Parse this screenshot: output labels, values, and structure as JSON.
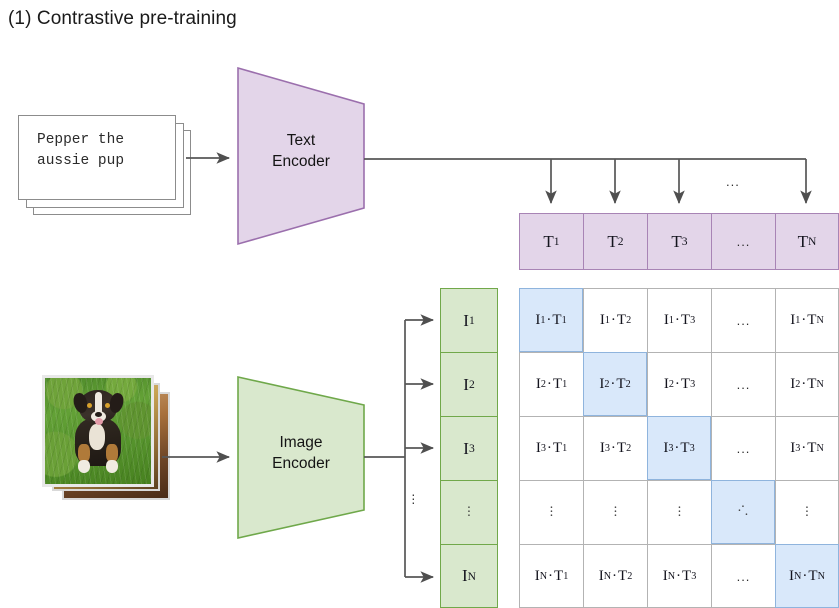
{
  "title": "(1) Contrastive pre-training",
  "text_input": {
    "name": "text-sample-stack",
    "sample": "Pepper the\naussie pup",
    "card_count": 3
  },
  "image_input": {
    "name": "image-sample-stack",
    "description": "Photo of an aussie puppy sitting on grass",
    "card_count": 3
  },
  "encoders": {
    "text": {
      "label": "Text\nEncoder",
      "fill": "#e3d5e9",
      "stroke": "#9b6fad"
    },
    "image": {
      "label": "Image\nEncoder",
      "fill": "#d9e8cd",
      "stroke": "#6fa84a"
    }
  },
  "text_embeddings": {
    "fill": "#e3d5e9",
    "stroke": "#a884b5",
    "cells": [
      "T₁",
      "T₂",
      "T₃",
      "…",
      "Tₙ"
    ],
    "labels": [
      {
        "base": "T",
        "sub": "1"
      },
      {
        "base": "T",
        "sub": "2"
      },
      {
        "base": "T",
        "sub": "3"
      },
      {
        "base": "...",
        "sub": ""
      },
      {
        "base": "T",
        "sub": "N"
      }
    ],
    "ellipsis_above": "..."
  },
  "image_embeddings": {
    "fill": "#d9e8cd",
    "stroke": "#71a84a",
    "labels": [
      {
        "base": "I",
        "sub": "1"
      },
      {
        "base": "I",
        "sub": "2"
      },
      {
        "base": "I",
        "sub": "3"
      },
      {
        "base": "⋮",
        "sub": ""
      },
      {
        "base": "I",
        "sub": "N"
      }
    ],
    "bus_ellipsis": "⋮"
  },
  "matrix": {
    "highlight_color": "#d9e8fa",
    "highlight_border": "#8fb4dd",
    "cell_border": "#b3b3b3",
    "rows": [
      [
        {
          "text": "I₁·T₁",
          "i": "1",
          "t": "1",
          "highlight": true
        },
        {
          "text": "I₁·T₂",
          "i": "1",
          "t": "2",
          "highlight": false
        },
        {
          "text": "I₁·T₃",
          "i": "1",
          "t": "3",
          "highlight": false
        },
        {
          "text": "...",
          "i": "",
          "t": "",
          "highlight": false
        },
        {
          "text": "I₁·Tₙ",
          "i": "1",
          "t": "N",
          "highlight": false
        }
      ],
      [
        {
          "text": "I₂·T₁",
          "i": "2",
          "t": "1",
          "highlight": false
        },
        {
          "text": "I₂·T₂",
          "i": "2",
          "t": "2",
          "highlight": true
        },
        {
          "text": "I₂·T₃",
          "i": "2",
          "t": "3",
          "highlight": false
        },
        {
          "text": "...",
          "i": "",
          "t": "",
          "highlight": false
        },
        {
          "text": "I₂·Tₙ",
          "i": "2",
          "t": "N",
          "highlight": false
        }
      ],
      [
        {
          "text": "I₃·T₁",
          "i": "3",
          "t": "1",
          "highlight": false
        },
        {
          "text": "I₃·T₂",
          "i": "3",
          "t": "2",
          "highlight": false
        },
        {
          "text": "I₃·T₃",
          "i": "3",
          "t": "3",
          "highlight": true
        },
        {
          "text": "...",
          "i": "",
          "t": "",
          "highlight": false
        },
        {
          "text": "I₃·Tₙ",
          "i": "3",
          "t": "N",
          "highlight": false
        }
      ],
      [
        {
          "text": "⋮",
          "i": "",
          "t": "",
          "highlight": false
        },
        {
          "text": "⋮",
          "i": "",
          "t": "",
          "highlight": false
        },
        {
          "text": "⋮",
          "i": "",
          "t": "",
          "highlight": false
        },
        {
          "text": "⋱",
          "i": "",
          "t": "",
          "highlight": true
        },
        {
          "text": "⋮",
          "i": "",
          "t": "",
          "highlight": false
        }
      ],
      [
        {
          "text": "Iₙ·T₁",
          "i": "N",
          "t": "1",
          "highlight": false
        },
        {
          "text": "Iₙ·T₂",
          "i": "N",
          "t": "2",
          "highlight": false
        },
        {
          "text": "Iₙ·T₃",
          "i": "N",
          "t": "3",
          "highlight": false
        },
        {
          "text": "...",
          "i": "",
          "t": "",
          "highlight": false
        },
        {
          "text": "Iₙ·Tₙ",
          "i": "N",
          "t": "N",
          "highlight": true
        }
      ]
    ]
  },
  "colors": {
    "purple_fill": "#e3d5e9",
    "purple_stroke": "#9b6fad",
    "green_fill": "#d9e8cd",
    "green_stroke": "#6fa84a",
    "blue_fill": "#d9e8fa",
    "blue_stroke": "#8fb4dd",
    "wire": "#575757"
  }
}
